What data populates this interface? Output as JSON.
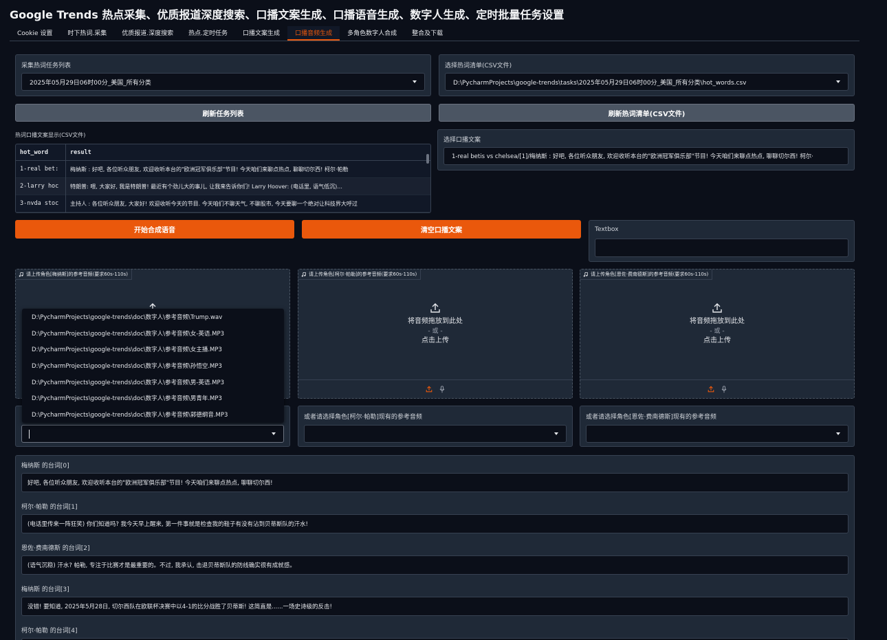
{
  "app_title": "Google Trends 热点采集、优质报道深度搜索、口播文案生成、口播语音生成、数字人生成、定时批量任务设置",
  "tabs": [
    "Cookie 设置",
    "时下热词.采集",
    "优质报道.深度搜索",
    "热点.定时任务",
    "口播文案生成",
    "口播音频生成",
    "多角色数字人合成",
    "整合及下载"
  ],
  "active_tab": "口播音频生成",
  "task_list": {
    "label": "采集热词任务列表",
    "value": "2025年05月29日06时00分_美国_所有分类"
  },
  "hot_csv": {
    "label": "选择热词清单(CSV文件)",
    "value": "D:\\PycharmProjects\\google-trends\\tasks\\2025年05月29日06时00分_美国_所有分类\\hot_words.csv"
  },
  "buttons": {
    "refresh_tasks": "刷新任务列表",
    "refresh_csv": "刷新热词清单(CSV文件)",
    "start_tts": "开始合成语音",
    "clear_script": "清空口播文案"
  },
  "table": {
    "label": "热词口播文案显示(CSV文件)",
    "headers": [
      "hot_word",
      "result"
    ],
    "rows": [
      [
        "1-real bet:",
        "梅纳斯 : 好吧, 各位听众朋友, 欢迎收听本台的\"欧洲冠军俱乐部\"节目! 今天咱们来聊点热点, 聊聊切尔西!  柯尔·帕勒"
      ],
      [
        "2-larry hoc",
        "特朗普: 喂, 大家好, 我是特朗普! 最近有个劲儿大的事儿, 让我来告诉你们!  Larry Hoover: (电话里, 语气低沉)..."
      ],
      [
        "3-nvda stoc",
        "主持人 : 各位听众朋友, 大家好! 欢迎收听今天的节目. 今天咱们不聊天气, 不聊股市, 今天要聊一个绝对让科技界大呼过"
      ]
    ]
  },
  "script_select": {
    "label": "选择口播文案",
    "value": "1-real betis vs chelsea/[1]/梅纳斯 : 好吧, 各位听众朋友, 欢迎收听本台的\"欧洲冠军俱乐部\"节目! 今天咱们来聊点热点, 聊聊切尔西! 柯尔·"
  },
  "textbox": {
    "label": "Textbox",
    "value": ""
  },
  "uploads": [
    {
      "label": "请上传角色[梅纳斯]的参考音频(要求60s-110s)"
    },
    {
      "label": "请上传角色[柯尔·帕勒]的参考音频(要求60s-110s)",
      "drop": "将音频拖放到此处",
      "or": "- 或 -",
      "click": "点击上传"
    },
    {
      "label": "请上传角色[恩佐·费南德斯]的参考音频(要求60s-110s)",
      "drop": "将音频拖放到此处",
      "or": "- 或 -",
      "click": "点击上传"
    }
  ],
  "dropdown_options": [
    "D:\\PycharmProjects\\google-trends\\doc\\数字人\\参考音频\\Trump.wav",
    "D:\\PycharmProjects\\google-trends\\doc\\数字人\\参考音频\\女-英语.MP3",
    "D:\\PycharmProjects\\google-trends\\doc\\数字人\\参考音频\\女主播.MP3",
    "D:\\PycharmProjects\\google-trends\\doc\\数字人\\参考音频\\孙悟空.MP3",
    "D:\\PycharmProjects\\google-trends\\doc\\数字人\\参考音频\\男-英语.MP3",
    "D:\\PycharmProjects\\google-trends\\doc\\数字人\\参考音频\\男青年.MP3",
    "D:\\PycharmProjects\\google-trends\\doc\\数字人\\参考音频\\郭德纲音.MP3"
  ],
  "existing_audio": [
    {
      "label": "",
      "value": ""
    },
    {
      "label": "或者请选择角色[柯尔·帕勒]现有的参考音频",
      "value": ""
    },
    {
      "label": "或者请选择角色[恩佐·费南德斯]现有的参考音频",
      "value": ""
    }
  ],
  "lines": [
    {
      "label": "梅纳斯 的台词[0]",
      "value": "好吧, 各位听众朋友, 欢迎收听本台的\"欧洲冠军俱乐部\"节目! 今天咱们来聊点热点, 聊聊切尔西!"
    },
    {
      "label": "柯尔·帕勒 的台词[1]",
      "value": "(电话里传来一阵狂笑) 你们知道吗? 我今天早上醒来, 第一件事就是检查我的鞋子有没有沾到贝蒂斯队的汗水!"
    },
    {
      "label": "恩佐·费南德斯 的台词[2]",
      "value": "(语气沉稳) 汗水? 帕勒, 专注于比赛才是最重要的。不过, 我承认, 击退贝蒂斯队的防线确实很有成就感。"
    },
    {
      "label": "梅纳斯 的台词[3]",
      "value": "没错! 要知道, 2025年5月28日, 切尔西队在欧联杯决赛中以4-1的比分战胜了贝蒂斯! 这简直是......一场史诗级的反击!"
    },
    {
      "label": "柯尔·帕勒 的台词[4]",
      "value": ""
    }
  ],
  "colors": {
    "accent": "#ea580c",
    "background": "#0b0f19",
    "panel": "#1f2937"
  }
}
